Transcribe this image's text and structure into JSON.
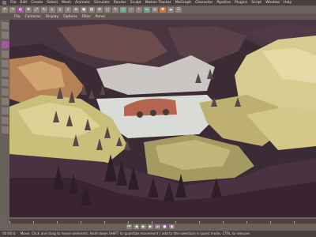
{
  "menu": [
    "File",
    "Edit",
    "Create",
    "Select",
    "Mesh",
    "Animate",
    "Simulate",
    "Render",
    "Sculpt",
    "Motion Tracker",
    "MoGraph",
    "Character",
    "Pipeline",
    "Plugins",
    "Script",
    "Window",
    "Help"
  ],
  "toolbar2": [
    "File",
    "Cameras",
    "Display",
    "Options",
    "Filter",
    "Panel"
  ],
  "status": {
    "frame": "00:00:0",
    "text": "Move: Click and drag to move elements. Hold down SHIFT to quantize movement / add to the selection in point mode, CTRL to remove."
  },
  "colors": {
    "accent": "#a15aa0",
    "ui_bg": "#6c615e",
    "menubar": "#4a3f3d"
  }
}
